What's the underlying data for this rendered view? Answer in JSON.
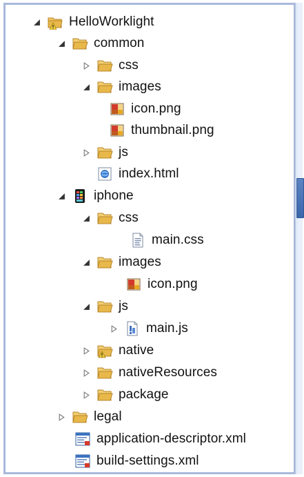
{
  "tree": {
    "items": [
      {
        "label": "HelloWorklight",
        "icon": "project-folder-warning-icon",
        "state": "expanded"
      },
      {
        "label": "common",
        "icon": "folder-open-icon",
        "state": "expanded"
      },
      {
        "label": "css",
        "icon": "folder-open-icon",
        "state": "collapsed"
      },
      {
        "label": "images",
        "icon": "folder-open-icon",
        "state": "expanded"
      },
      {
        "label": "icon.png",
        "icon": "image-file-icon",
        "state": "none"
      },
      {
        "label": "thumbnail.png",
        "icon": "image-file-icon",
        "state": "none"
      },
      {
        "label": "js",
        "icon": "folder-open-icon",
        "state": "collapsed"
      },
      {
        "label": "index.html",
        "icon": "html-file-icon",
        "state": "none"
      },
      {
        "label": "iphone",
        "icon": "iphone-environment-icon",
        "state": "expanded"
      },
      {
        "label": "css",
        "icon": "folder-open-icon",
        "state": "expanded"
      },
      {
        "label": "main.css",
        "icon": "css-file-icon",
        "state": "none"
      },
      {
        "label": "images",
        "icon": "folder-open-icon",
        "state": "expanded"
      },
      {
        "label": "icon.png",
        "icon": "image-file-icon",
        "state": "none"
      },
      {
        "label": "js",
        "icon": "folder-open-icon",
        "state": "expanded"
      },
      {
        "label": "main.js",
        "icon": "js-file-icon",
        "state": "collapsed"
      },
      {
        "label": "native",
        "icon": "folder-warning-icon",
        "state": "collapsed"
      },
      {
        "label": "nativeResources",
        "icon": "folder-open-icon",
        "state": "collapsed"
      },
      {
        "label": "package",
        "icon": "folder-open-icon",
        "state": "collapsed"
      },
      {
        "label": "legal",
        "icon": "folder-open-icon",
        "state": "collapsed"
      },
      {
        "label": "application-descriptor.xml",
        "icon": "xml-file-icon",
        "state": "none"
      },
      {
        "label": "build-settings.xml",
        "icon": "xml-file-icon",
        "state": "none"
      }
    ]
  },
  "colors": {
    "folder": "#e8b84a",
    "folder_dark": "#b7862a",
    "frame_border": "#a8b8dc",
    "side_tab": "#3c67aa"
  }
}
